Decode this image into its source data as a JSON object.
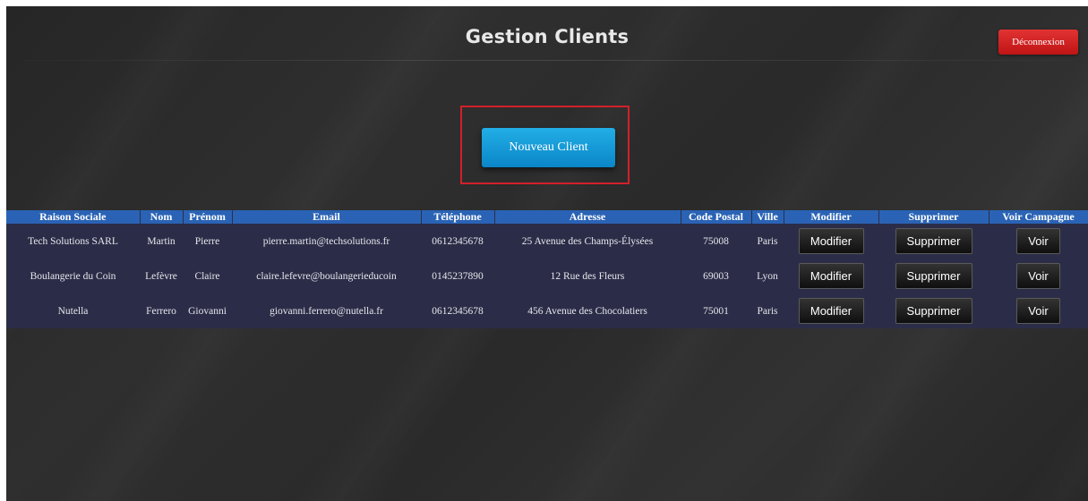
{
  "header": {
    "title": "Gestion Clients",
    "logout_label": "Déconnexion"
  },
  "actions": {
    "new_client_label": "Nouveau Client"
  },
  "table": {
    "columns": [
      "Raison Sociale",
      "Nom",
      "Prénom",
      "Email",
      "Téléphone",
      "Adresse",
      "Code Postal",
      "Ville",
      "Modifier",
      "Supprimer",
      "Voir Campagne"
    ],
    "rows": [
      {
        "raison_sociale": "Tech Solutions SARL",
        "nom": "Martin",
        "prenom": "Pierre",
        "email": "pierre.martin@techsolutions.fr",
        "telephone": "0612345678",
        "adresse": "25 Avenue des Champs-Élysées",
        "code_postal": "75008",
        "ville": "Paris",
        "modifier_label": "Modifier",
        "supprimer_label": "Supprimer",
        "voir_label": "Voir"
      },
      {
        "raison_sociale": "Boulangerie du Coin",
        "nom": "Lefèvre",
        "prenom": "Claire",
        "email": "claire.lefevre@boulangerieducoin",
        "telephone": "0145237890",
        "adresse": "12 Rue des Fleurs",
        "code_postal": "69003",
        "ville": "Lyon",
        "modifier_label": "Modifier",
        "supprimer_label": "Supprimer",
        "voir_label": "Voir"
      },
      {
        "raison_sociale": "Nutella",
        "nom": "Ferrero",
        "prenom": "Giovanni",
        "email": "giovanni.ferrero@nutella.fr",
        "telephone": "0612345678",
        "adresse": "456 Avenue des Chocolatiers",
        "code_postal": "75001",
        "ville": "Paris",
        "modifier_label": "Modifier",
        "supprimer_label": "Supprimer",
        "voir_label": "Voir"
      }
    ]
  },
  "colors": {
    "background": "#2a2a2a",
    "table_header": "#2a63b5",
    "table_row": "#2b2d48",
    "logout": "#d22020",
    "primary": "#1399d6",
    "highlight": "#d2202a"
  }
}
